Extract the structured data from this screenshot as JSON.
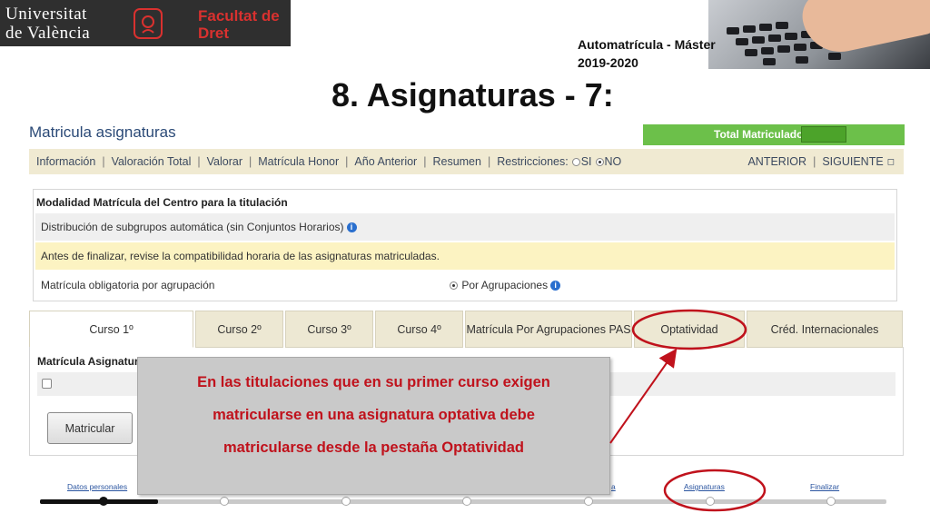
{
  "slide": {
    "logo_university": [
      "Universitat",
      "de València"
    ],
    "logo_faculty": [
      "Facultat de",
      "Dret"
    ],
    "note_line1": "Automatrícula - Máster",
    "note_line2": "2019-2020",
    "title": "8. Asignaturas - 7:"
  },
  "app": {
    "title": "Matricula asignaturas",
    "total_label": "Total Matriculado",
    "menu": {
      "items": [
        "Información",
        "Valoración Total",
        "Valorar",
        "Matrícula Honor",
        "Año Anterior",
        "Resumen"
      ],
      "restrictions_label": "Restricciones:",
      "option_si": "SI",
      "option_no": "NO",
      "anterior": "ANTERIOR",
      "siguiente": "SIGUIENTE"
    },
    "modalidad": {
      "heading": "Modalidad Matrícula del Centro para la titulación",
      "distribucion": "Distribución de subgrupos automática (sin Conjuntos Horarios)",
      "aviso": "Antes de finalizar, revise la compatibilidad horaria de las asignaturas matriculadas.",
      "obligatoria": "Matrícula obligatoria por agrupación",
      "agrupaciones": "Por Agrupaciones"
    },
    "tabs": [
      "Curso 1º",
      "Curso 2º",
      "Curso 3º",
      "Curso 4º",
      "Matrícula Por Agrupaciones PAS",
      "Optatividad",
      "Créd. Internacionales"
    ],
    "lower_heading": "Matrícula Asignatura",
    "matricular_button": "Matricular"
  },
  "steps": {
    "labels": [
      "Datos personales",
      "a",
      "Asignaturas",
      "Finalizar"
    ]
  },
  "callout": {
    "lines": [
      "En las titulaciones que en su primer curso exigen",
      "matricularse en una asignatura optativa debe",
      "matricularse desde la pestaña Optatividad"
    ]
  },
  "colors": {
    "callout_text": "#c0121c",
    "annotation": "#c0121c",
    "total_bar": "#6cc04a",
    "menu_bar": "#f0ead2"
  }
}
